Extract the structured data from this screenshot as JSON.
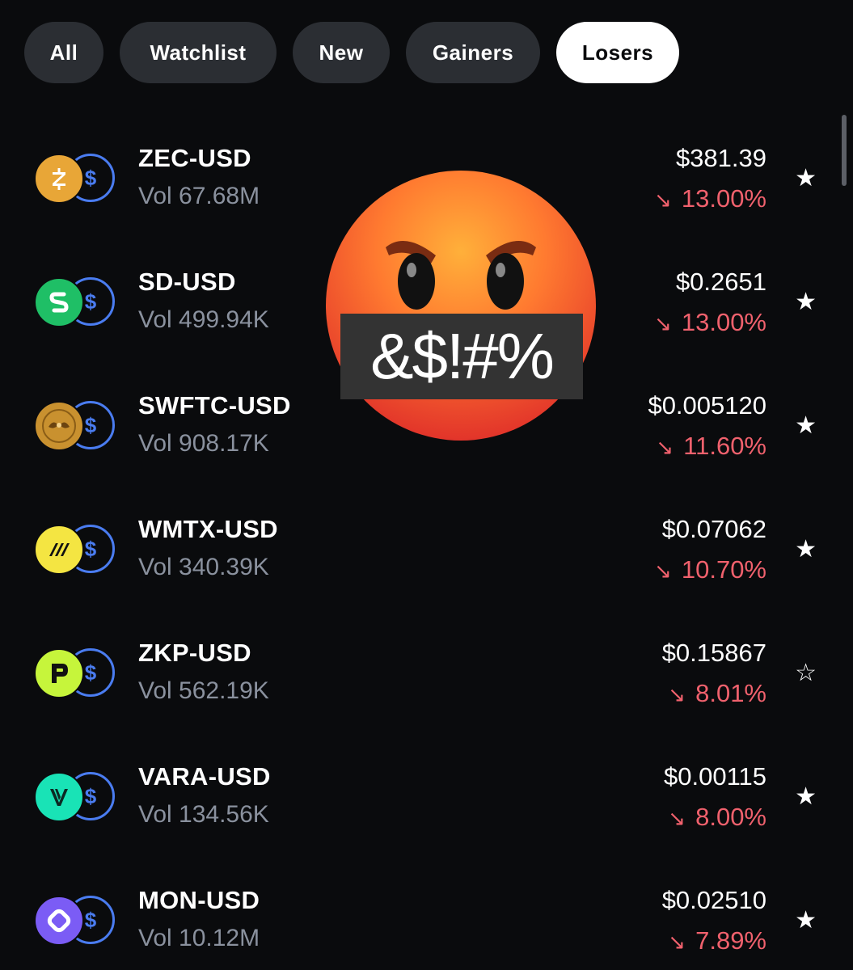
{
  "tabs": [
    {
      "label": "All",
      "active": false
    },
    {
      "label": "Watchlist",
      "active": false
    },
    {
      "label": "New",
      "active": false
    },
    {
      "label": "Gainers",
      "active": false
    },
    {
      "label": "Losers",
      "active": true
    }
  ],
  "colors": {
    "background": "#0a0b0d",
    "negative": "#f0616d",
    "usd_ring": "#4a7cf0",
    "muted": "#8a919e"
  },
  "assets": [
    {
      "pair": "ZEC-USD",
      "volume": "Vol 67.68M",
      "price": "$381.39",
      "change": "13.00%",
      "watchlisted": true,
      "coin_icon": "zcash-icon",
      "coin_color": "#e8a637"
    },
    {
      "pair": "SD-USD",
      "volume": "Vol 499.94K",
      "price": "$0.2651",
      "change": "13.00%",
      "watchlisted": true,
      "coin_icon": "stader-icon",
      "coin_color": "#1fbf66"
    },
    {
      "pair": "SWFTC-USD",
      "volume": "Vol 908.17K",
      "price": "$0.005120",
      "change": "11.60%",
      "watchlisted": true,
      "coin_icon": "swftcoin-icon",
      "coin_color": "#c9912f"
    },
    {
      "pair": "WMTX-USD",
      "volume": "Vol 340.39K",
      "price": "$0.07062",
      "change": "10.70%",
      "watchlisted": true,
      "coin_icon": "worldmobile-icon",
      "coin_color": "#f4e542"
    },
    {
      "pair": "ZKP-USD",
      "volume": "Vol 562.19K",
      "price": "$0.15867",
      "change": "8.01%",
      "watchlisted": false,
      "coin_icon": "zkp-icon",
      "coin_color": "#c6f53b"
    },
    {
      "pair": "VARA-USD",
      "volume": "Vol 134.56K",
      "price": "$0.00115",
      "change": "8.00%",
      "watchlisted": true,
      "coin_icon": "vara-icon",
      "coin_color": "#19e3b6"
    },
    {
      "pair": "MON-USD",
      "volume": "Vol 10.12M",
      "price": "$0.02510",
      "change": "7.89%",
      "watchlisted": true,
      "coin_icon": "monad-icon",
      "coin_color": "#7b5cf5"
    }
  ],
  "icons": {
    "usd": "$",
    "down_arrow": "↘",
    "star_filled": "★",
    "star_outline": "☆"
  },
  "overlay": {
    "emoji": "angry-face-icon",
    "censor_text": "&$!#%"
  }
}
